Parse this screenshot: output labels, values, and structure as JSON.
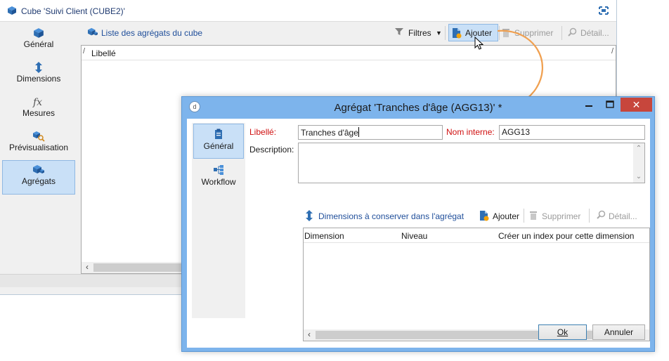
{
  "bg_window": {
    "title": "Cube 'Suivi Client (CUBE2)'",
    "sidebar": [
      {
        "label": "Général",
        "icon": "cube-icon"
      },
      {
        "label": "Dimensions",
        "icon": "updown-arrow-icon"
      },
      {
        "label": "Mesures",
        "icon": "fx-icon"
      },
      {
        "label": "Prévisualisation",
        "icon": "preview-icon"
      },
      {
        "label": "Agrégats",
        "icon": "cubes-icon",
        "active": true
      }
    ],
    "toolbar": {
      "list_link": "Liste des agrégats du cube",
      "filters": "Filtres",
      "add": "Ajouter",
      "delete": "Supprimer",
      "detail": "Détail..."
    },
    "list": {
      "column": "Libellé"
    }
  },
  "dialog": {
    "title": "Agrégat 'Tranches d'âge (AGG13)' *",
    "sidebar": [
      {
        "label": "Général",
        "icon": "clipboard-icon",
        "active": true
      },
      {
        "label": "Workflow",
        "icon": "workflow-icon"
      }
    ],
    "form": {
      "label_label": "Libellé:",
      "label_value": "Tranches d'âge",
      "internal_label": "Nom interne:",
      "internal_value": "AGG13",
      "description_label": "Description:",
      "description_value": ""
    },
    "inner_toolbar": {
      "dims_link": "Dimensions à conserver dans l'agrégat",
      "add": "Ajouter",
      "delete": "Supprimer",
      "detail": "Détail..."
    },
    "grid": {
      "columns": [
        "Dimension",
        "Niveau",
        "Créer un index pour cette dimension"
      ]
    },
    "buttons": {
      "ok": "Ok",
      "cancel": "Annuler"
    }
  },
  "colors": {
    "accent_blue": "#1f4e9a",
    "dialog_frame": "#7db4ec",
    "required_red": "#d01010",
    "arrow_orange": "#f0a050",
    "close_red": "#c7463c"
  }
}
